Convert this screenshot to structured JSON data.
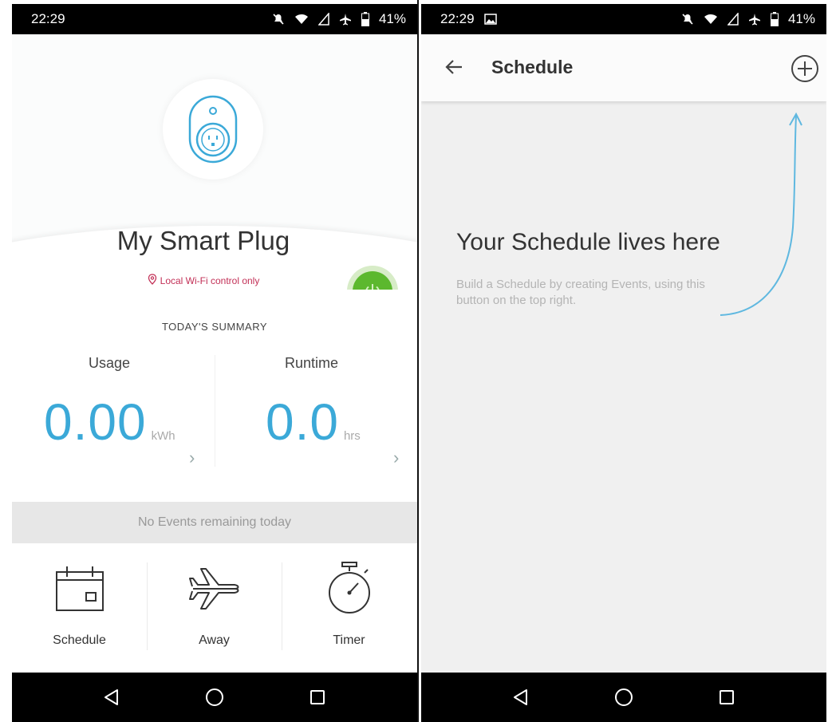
{
  "status_bar": {
    "time": "22:29",
    "battery": "41%"
  },
  "device": {
    "name": "My Smart Plug",
    "connection_note": "Local Wi-Fi control only"
  },
  "summary": {
    "title": "TODAY'S SUMMARY",
    "usage": {
      "label": "Usage",
      "value": "0.00",
      "unit": "kWh"
    },
    "runtime": {
      "label": "Runtime",
      "value": "0.0",
      "unit": "hrs"
    }
  },
  "events_status": "No Events remaining today",
  "actions": [
    {
      "label": "Schedule",
      "icon": "calendar-icon"
    },
    {
      "label": "Away",
      "icon": "airplane-icon"
    },
    {
      "label": "Timer",
      "icon": "stopwatch-icon"
    }
  ],
  "schedule_screen": {
    "title": "Schedule",
    "empty_title": "Your Schedule lives here",
    "empty_description": "Build a Schedule by creating Events, using this button on the top right."
  },
  "colors": {
    "accent_blue": "#3ba9d8",
    "power_green": "#5cb82e",
    "warning_red": "#c22f56"
  },
  "nav_icons": [
    "back-triangle-icon",
    "home-circle-icon",
    "recents-square-icon"
  ]
}
